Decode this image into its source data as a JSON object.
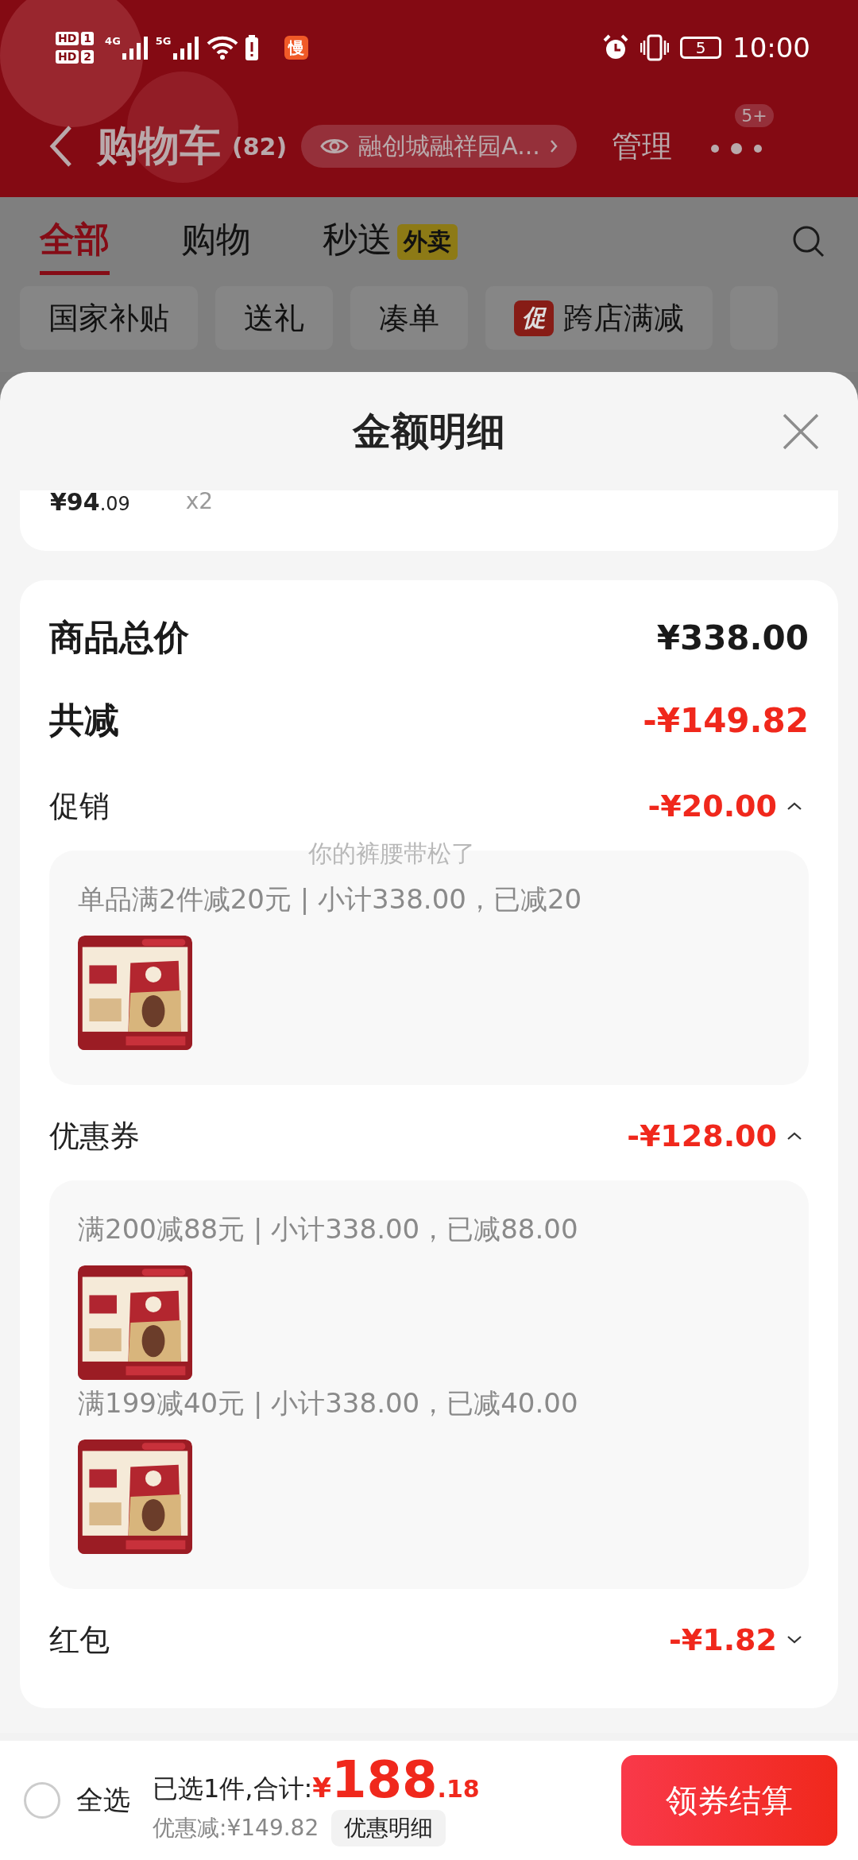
{
  "status_bar": {
    "sims": [
      {
        "tag": "HD",
        "slot": "1"
      },
      {
        "tag": "HD",
        "slot": "2"
      }
    ],
    "networks": [
      "4G",
      "5G"
    ],
    "app_badge": "慢",
    "battery": "5",
    "time": "10:00"
  },
  "header": {
    "title": "购物车",
    "count": "(82)",
    "address": "融创城融祥园A...",
    "manage": "管理",
    "badge": "5+"
  },
  "tabs": [
    {
      "label": "全部",
      "selected": true
    },
    {
      "label": "购物",
      "selected": false
    },
    {
      "label": "秒送",
      "tag": "外卖",
      "selected": false
    }
  ],
  "chips": [
    {
      "label": "国家补贴"
    },
    {
      "label": "送礼"
    },
    {
      "label": "凑单"
    },
    {
      "label": "跨店满减",
      "badge": "促"
    }
  ],
  "sheet": {
    "title": "金额明细",
    "partial_item": {
      "price": "¥94",
      "price_decimal": ".09",
      "quantity": "x2"
    },
    "total": {
      "label": "商品总价",
      "amount": "¥338.00"
    },
    "reduction": {
      "label": "共减",
      "amount": "-¥149.82"
    },
    "sections": [
      {
        "label": "促销",
        "amount": "-¥20.00",
        "expanded": true,
        "rules": [
          {
            "text": "单品满2件减20元 | 小计338.00，已减20"
          }
        ]
      },
      {
        "label": "优惠券",
        "amount": "-¥128.00",
        "expanded": true,
        "rules": [
          {
            "text": "满200减88元 | 小计338.00，已减88.00"
          },
          {
            "text": "满199减40元 | 小计338.00，已减40.00"
          }
        ]
      },
      {
        "label": "红包",
        "amount": "-¥1.82",
        "expanded": false
      }
    ],
    "toast": "你的裤腰带松了"
  },
  "bottom_bar": {
    "select_all": {
      "label": "全选",
      "checked": false
    },
    "selected_text": "已选1件,合计:",
    "currency": "¥",
    "price": "188",
    "price_decimal": ".18",
    "discount": "优惠减:¥149.82",
    "detail_button": "优惠明细",
    "checkout": "领券结算"
  }
}
